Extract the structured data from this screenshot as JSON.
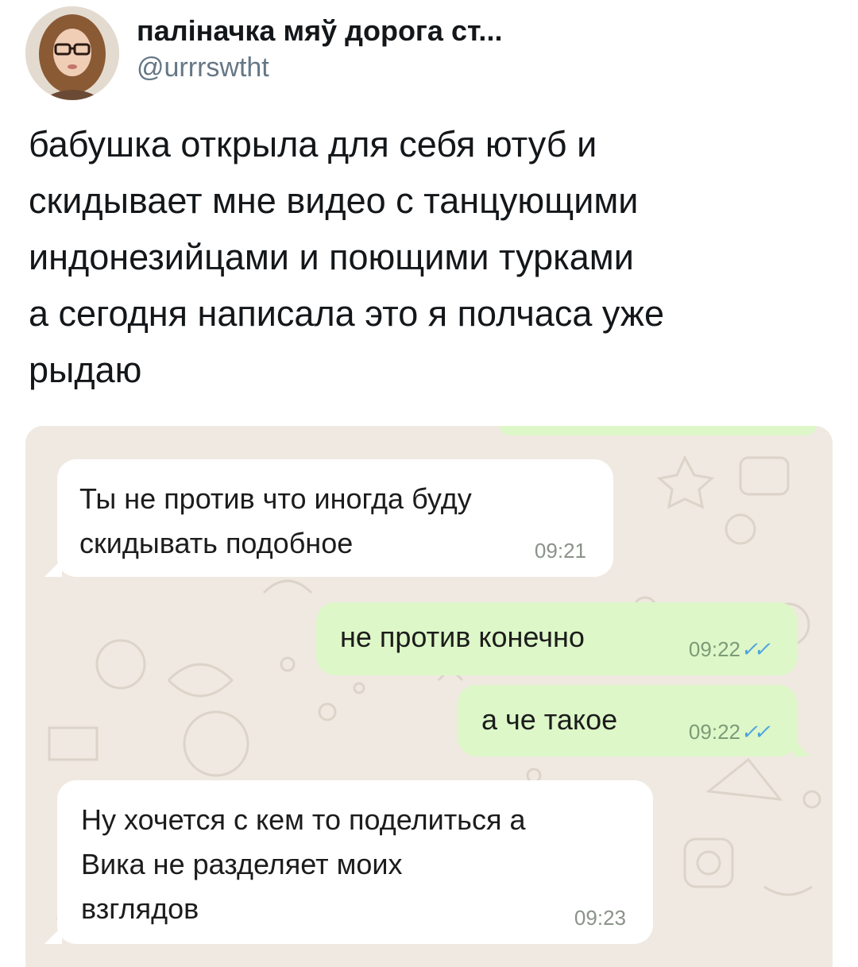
{
  "tweet": {
    "author_name": "паліначка мяў дорога ст...",
    "author_handle": "@urrrswtht",
    "text": "бабушка открыла для себя ютуб и\nскидывает мне видео с танцующими\nиндонезийцами и поющими турками\nа сегодня написала это я полчаса уже\nрыдаю"
  },
  "chat": {
    "messages": [
      {
        "direction": "incoming",
        "text": "Ты не против что иногда буду\nскидывать подобное",
        "time": "09:21"
      },
      {
        "direction": "outgoing",
        "text": "не против конечно",
        "time": "09:22",
        "status_icon": "double-check-icon"
      },
      {
        "direction": "outgoing",
        "text": "а че такое",
        "time": "09:22",
        "status_icon": "double-check-icon"
      },
      {
        "direction": "incoming",
        "text": "Ну хочется с кем то поделиться а\nВика не разделяет моих\nвзглядов",
        "time": "09:23"
      }
    ],
    "colors": {
      "background": "#efe9e1",
      "incoming_bubble": "#ffffff",
      "outgoing_bubble": "#ddf7c8",
      "read_ticks": "#4fa3e0"
    }
  }
}
